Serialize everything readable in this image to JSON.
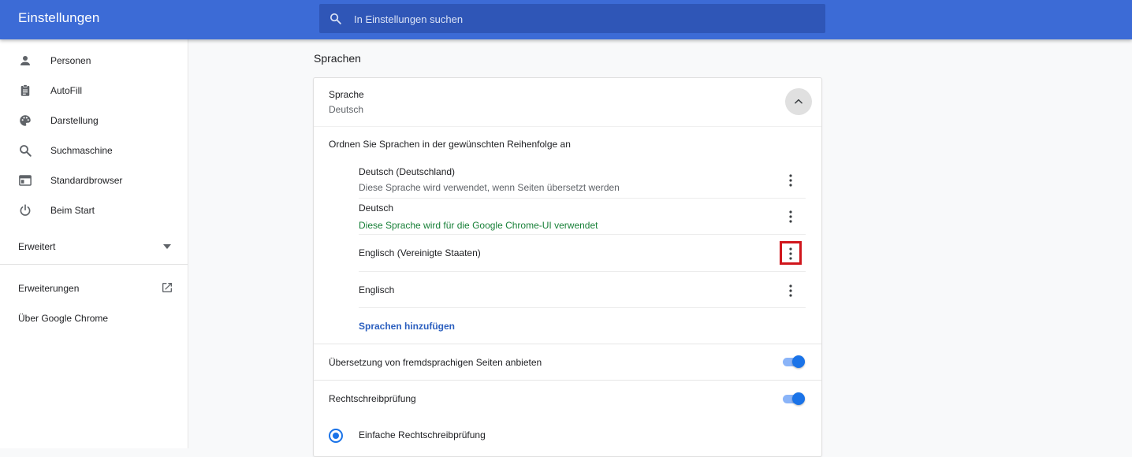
{
  "header": {
    "title": "Einstellungen",
    "search_placeholder": "In Einstellungen suchen"
  },
  "sidebar": {
    "items": [
      {
        "label": "Personen",
        "icon": "person-icon"
      },
      {
        "label": "AutoFill",
        "icon": "clipboard-icon"
      },
      {
        "label": "Darstellung",
        "icon": "palette-icon"
      },
      {
        "label": "Suchmaschine",
        "icon": "search-icon"
      },
      {
        "label": "Standardbrowser",
        "icon": "browser-window-icon"
      },
      {
        "label": "Beim Start",
        "icon": "power-icon"
      }
    ],
    "advanced_label": "Erweitert",
    "extensions_label": "Erweiterungen",
    "about_label": "Über Google Chrome"
  },
  "main": {
    "section_title": "Sprachen",
    "language_header": {
      "label": "Sprache",
      "value": "Deutsch"
    },
    "order_instruction": "Ordnen Sie Sprachen in der gewünschten Reihenfolge an",
    "languages": [
      {
        "name": "Deutsch (Deutschland)",
        "note": "Diese Sprache wird verwendet, wenn Seiten übersetzt werden"
      },
      {
        "name": "Deutsch",
        "note": "Diese Sprache wird für die Google Chrome-UI verwendet"
      },
      {
        "name": "Englisch (Vereinigte Staaten)",
        "note": ""
      },
      {
        "name": "Englisch",
        "note": ""
      }
    ],
    "add_languages_label": "Sprachen hinzufügen",
    "translate_offer_label": "Übersetzung von fremdsprachigen Seiten anbieten",
    "translate_offer_enabled": true,
    "spellcheck_label": "Rechtschreibprüfung",
    "spellcheck_enabled": true,
    "basic_spellcheck_label": "Einfache Rechtschreibprüfung",
    "basic_spellcheck_selected": true
  },
  "colors": {
    "header": "#3c6bd6",
    "accent": "#1a73e8",
    "highlight": "#d0161c"
  }
}
